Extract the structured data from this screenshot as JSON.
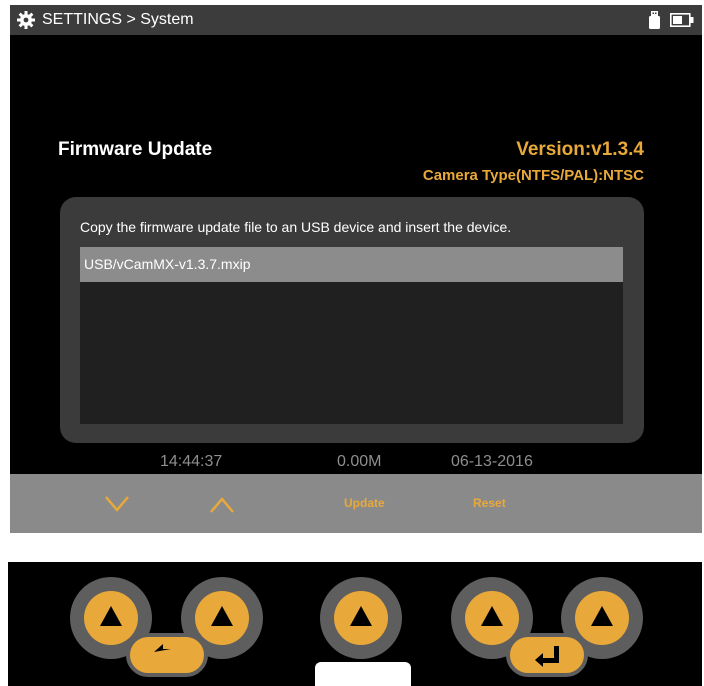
{
  "header": {
    "title": "SETTINGS > System",
    "icons": [
      "gear-icon",
      "usb-icon",
      "battery-icon"
    ]
  },
  "firmware": {
    "title": "Firmware Update",
    "version": "Version:v1.3.4",
    "camera_type": "Camera Type(NTFS/PAL):NTSC",
    "instruction": "Copy the firmware update file to an USB device and insert the device.",
    "files": [
      "USB/vCamMX-v1.3.7.mxip"
    ]
  },
  "status": {
    "time": "14:44:37",
    "size": "0.00M",
    "date": "06-13-2016"
  },
  "softkeys": {
    "down": "chevron-down-icon",
    "up": "chevron-up-icon",
    "update": "Update",
    "reset": "Reset"
  },
  "hardware": {
    "buttons": [
      "triangle-up-icon",
      "triangle-up-icon",
      "triangle-up-icon",
      "triangle-up-icon",
      "triangle-up-icon"
    ],
    "back": "back-arrow-icon",
    "enter": "enter-arrow-icon"
  },
  "colors": {
    "accent": "#e9a93a",
    "screen_bg": "#000000",
    "topbar_bg": "#3c3c3c",
    "panel_bg": "#3b3b3b",
    "selected_row": "#8c8c8c",
    "softkey_bar": "#8a8a8a",
    "status_text": "#8e8e8e",
    "button_ring": "#5e5e5e"
  }
}
